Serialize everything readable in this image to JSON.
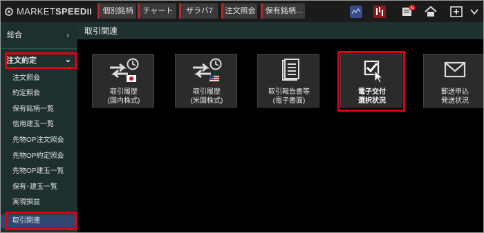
{
  "app": {
    "logo_part1": "MARKET",
    "logo_part2": "SPEED",
    "logo_suffix": "II"
  },
  "tabs": [
    {
      "label": "個別銘柄"
    },
    {
      "label": "チャート"
    },
    {
      "label": "ザラバ7"
    },
    {
      "label": "注文照会"
    },
    {
      "label": "保有銘柄..."
    }
  ],
  "toolbar_icons": [
    "window-icon",
    "price-chart-icon",
    "news-chart-icon",
    "notification-icon",
    "home-icon",
    "add-window-icon",
    "dropdown-icon"
  ],
  "notification_badge": "N",
  "sidebar": {
    "top_label": "総合",
    "category_label": "注文約定",
    "items": [
      {
        "label": "注文照会"
      },
      {
        "label": "約定照会"
      },
      {
        "label": "保有銘柄一覧"
      },
      {
        "label": "信用建玉一覧"
      },
      {
        "label": "先物OP注文照会"
      },
      {
        "label": "先物OP約定照会"
      },
      {
        "label": "先物OP建玉一覧"
      },
      {
        "label": "保有･建玉一覧"
      },
      {
        "label": "実現損益"
      },
      {
        "label": "取引関連"
      }
    ],
    "active_item": "取引関連"
  },
  "content": {
    "title": "取引関連",
    "cards": [
      {
        "line1": "取引履歴",
        "line2": "(国内株式)",
        "icon": "trade-history-jp-icon"
      },
      {
        "line1": "取引履歴",
        "line2": "(米国株式)",
        "icon": "trade-history-us-icon"
      },
      {
        "line1": "取引報告書等",
        "line2": "(電子書面)",
        "icon": "document-icon"
      },
      {
        "line1": "電子交付",
        "line2": "選択状況",
        "icon": "checkbox-cursor-icon"
      },
      {
        "line1": "郵送申込",
        "line2": "発送状況",
        "icon": "envelope-icon"
      }
    ],
    "selected_card": "電子交付 選択状況"
  },
  "colors": {
    "highlight": "#e1000f",
    "sidebar_bg": "#1e2f2f",
    "active_item_bg": "#2e4770",
    "tab_accent": "#b02b2b",
    "card_bg": "#2b2b2b"
  }
}
